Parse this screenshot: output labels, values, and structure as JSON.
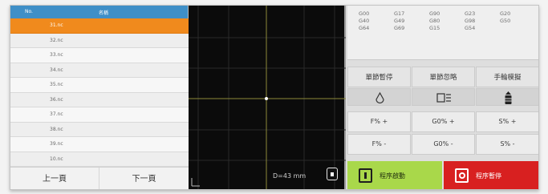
{
  "program_list": {
    "header": {
      "col_no": "No.",
      "col_name": "名稱"
    },
    "rows": [
      {
        "num": "",
        "name": "31.nc",
        "selected": true
      },
      {
        "num": "",
        "name": "32.nc",
        "selected": false
      },
      {
        "num": "",
        "name": "33.nc",
        "selected": false
      },
      {
        "num": "",
        "name": "34.nc",
        "selected": false
      },
      {
        "num": "",
        "name": "35.nc",
        "selected": false
      },
      {
        "num": "",
        "name": "36.nc",
        "selected": false
      },
      {
        "num": "",
        "name": "37.nc",
        "selected": false
      },
      {
        "num": "",
        "name": "38.nc",
        "selected": false
      },
      {
        "num": "",
        "name": "39.nc",
        "selected": false
      },
      {
        "num": "",
        "name": "10.nc",
        "selected": false
      }
    ],
    "pager": {
      "prev": "上一頁",
      "next": "下一頁"
    }
  },
  "graph": {
    "diameter_label": "D=43 mm"
  },
  "modal_gcodes": [
    [
      "G00",
      "G17",
      "G90",
      "G23",
      "G20"
    ],
    [
      "G40",
      "G49",
      "G80",
      "G98",
      "G50"
    ],
    [
      "G64",
      "G69",
      "G15",
      "G54",
      ""
    ]
  ],
  "mode_buttons": [
    {
      "label": "單節暫停"
    },
    {
      "label": "單節忽略"
    },
    {
      "label": "手輪模擬"
    }
  ],
  "icon_buttons": [
    {
      "icon": "coolant-drop-icon"
    },
    {
      "icon": "skip-block-icon"
    },
    {
      "icon": "handwheel-icon"
    }
  ],
  "override_buttons": {
    "increase": [
      "F% +",
      "G0% +",
      "S% +"
    ],
    "decrease": [
      "F% -",
      "G0% -",
      "S% -"
    ]
  },
  "actions": {
    "start_label": "程序啟動",
    "pause_label": "程序暫停"
  },
  "colors": {
    "selected_row": "#f08a1d",
    "header": "#3f8fc7",
    "start": "#a9d84a",
    "pause": "#d82020",
    "crosshair": "#c8c24a"
  }
}
